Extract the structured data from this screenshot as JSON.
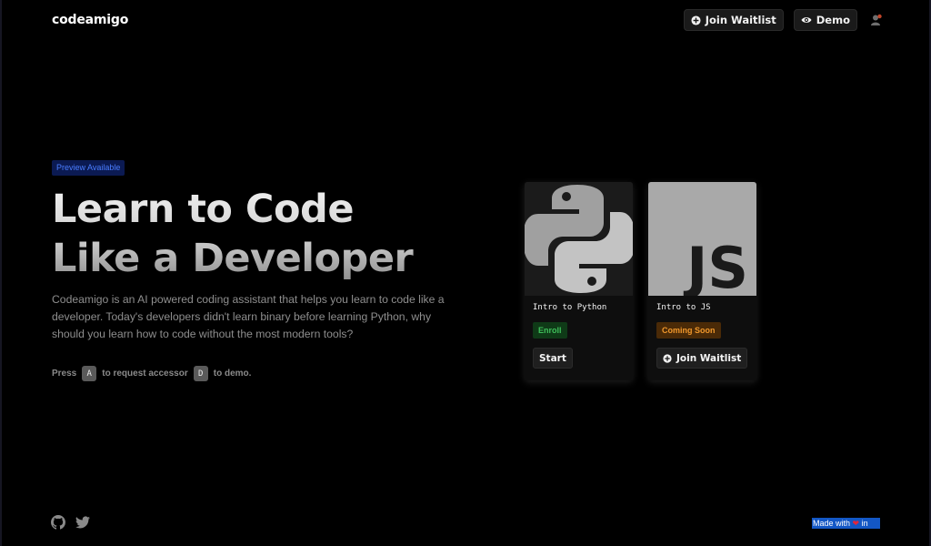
{
  "header": {
    "logo": "codeamigo",
    "join_waitlist_label": "Join Waitlist",
    "demo_label": "Demo"
  },
  "hero": {
    "badge": "Preview Available",
    "title_line1": "Learn to Code",
    "title_line2": "Like a Developer",
    "description": "Codeamigo is an AI powered coding assistant that helps you learn to code like a developer. Today's developers didn't learn binary before learning Python, why should you learn how to code without the most modern tools?",
    "press": {
      "prefix": "Press",
      "key_a": "A",
      "middle": "to request accessor",
      "key_d": "D",
      "suffix": "to demo."
    }
  },
  "cards": [
    {
      "title": "Intro to Python",
      "tag": "Enroll",
      "button": "Start",
      "image_icon": "python-logo"
    },
    {
      "title": "Intro to JS",
      "tag": "Coming Soon",
      "button": "Join Waitlist",
      "image_icon": "js-logo",
      "image_text": "JS"
    }
  ],
  "footer": {
    "made_with_prefix": "Made with",
    "heart": "❤",
    "made_with_suffix": "in"
  },
  "colors": {
    "background": "#000000",
    "badge_bg": "#0b1a52",
    "badge_text": "#4a7dff",
    "enroll_bg": "#0f3a17",
    "enroll_text": "#3fbf5a",
    "soon_bg": "#4a2a07",
    "soon_text": "#f0982c",
    "made_with_bg": "#1357c5"
  }
}
